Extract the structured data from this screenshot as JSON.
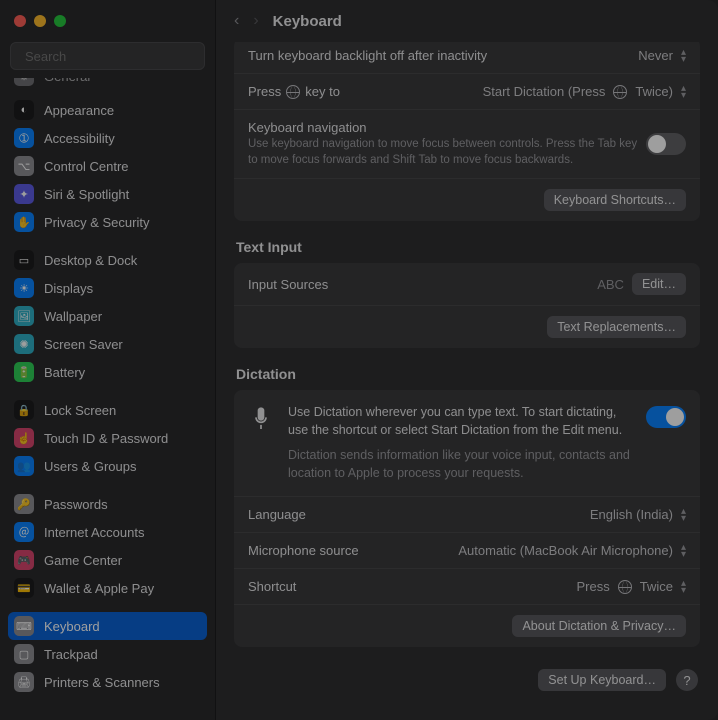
{
  "header": {
    "title": "Keyboard"
  },
  "search": {
    "placeholder": "Search"
  },
  "sidebar": {
    "items": [
      {
        "label": "General",
        "color": "bg-gray",
        "glyph": "⚙"
      },
      {
        "label": "Appearance",
        "color": "bg-black",
        "glyph": "◐"
      },
      {
        "label": "Accessibility",
        "color": "bg-blue",
        "glyph": "➀"
      },
      {
        "label": "Control Centre",
        "color": "bg-gray",
        "glyph": "⌥"
      },
      {
        "label": "Siri & Spotlight",
        "color": "bg-purple",
        "glyph": "✦"
      },
      {
        "label": "Privacy & Security",
        "color": "bg-blue",
        "glyph": "✋"
      },
      {
        "label": "Desktop & Dock",
        "color": "bg-black",
        "glyph": "▭"
      },
      {
        "label": "Displays",
        "color": "bg-blue",
        "glyph": "☀"
      },
      {
        "label": "Wallpaper",
        "color": "bg-teal",
        "glyph": "🖼"
      },
      {
        "label": "Screen Saver",
        "color": "bg-teal",
        "glyph": "✺"
      },
      {
        "label": "Battery",
        "color": "bg-green",
        "glyph": "🔋"
      },
      {
        "label": "Lock Screen",
        "color": "bg-black",
        "glyph": "🔒"
      },
      {
        "label": "Touch ID & Password",
        "color": "bg-pink",
        "glyph": "☝"
      },
      {
        "label": "Users & Groups",
        "color": "bg-blue",
        "glyph": "👥"
      },
      {
        "label": "Passwords",
        "color": "bg-gray",
        "glyph": "🔑"
      },
      {
        "label": "Internet Accounts",
        "color": "bg-blue",
        "glyph": "＠"
      },
      {
        "label": "Game Center",
        "color": "bg-pink",
        "glyph": "🎮"
      },
      {
        "label": "Wallet & Apple Pay",
        "color": "bg-black",
        "glyph": "💳"
      },
      {
        "label": "Keyboard",
        "color": "bg-gray",
        "glyph": "⌨",
        "selected": true
      },
      {
        "label": "Trackpad",
        "color": "bg-gray",
        "glyph": "▢"
      },
      {
        "label": "Printers & Scanners",
        "color": "bg-gray",
        "glyph": "🖨"
      }
    ]
  },
  "keyboard_panel": {
    "backlight_label": "Turn keyboard backlight off after inactivity",
    "backlight_value": "Never",
    "press_label_pre": "Press",
    "press_label_post": "key to",
    "press_value_pre": "Start Dictation (Press",
    "press_value_post": "Twice)",
    "nav_title": "Keyboard navigation",
    "nav_sub": "Use keyboard navigation to move focus between controls. Press the Tab key to move focus forwards and Shift Tab to move focus backwards.",
    "nav_on": false,
    "shortcuts_btn": "Keyboard Shortcuts…"
  },
  "text_input": {
    "section": "Text Input",
    "input_sources_label": "Input Sources",
    "input_sources_value": "ABC",
    "edit_btn": "Edit…",
    "replacements_btn": "Text Replacements…"
  },
  "dictation": {
    "section": "Dictation",
    "desc1": "Use Dictation wherever you can type text. To start dictating, use the shortcut or select Start Dictation from the Edit menu.",
    "desc2": "Dictation sends information like your voice input, contacts and location to Apple to process your requests.",
    "on": true,
    "language_label": "Language",
    "language_value": "English (India)",
    "mic_label": "Microphone source",
    "mic_value": "Automatic (MacBook Air Microphone)",
    "shortcut_label": "Shortcut",
    "shortcut_value_pre": "Press",
    "shortcut_value_post": "Twice",
    "about_btn": "About Dictation & Privacy…"
  },
  "footer": {
    "setup_btn": "Set Up Keyboard…"
  }
}
